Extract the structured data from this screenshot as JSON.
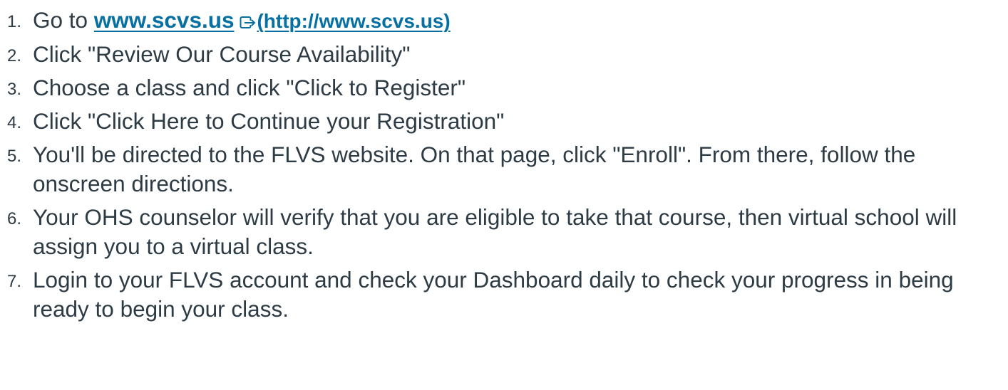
{
  "steps": [
    {
      "number": "1.",
      "prefix": "Go to ",
      "link_text": "www.scvs.us",
      "link_url_label": "(http://www.scvs.us)",
      "icon": "external-link-icon"
    },
    {
      "number": "2.",
      "text": "Click \"Review Our Course Availability\""
    },
    {
      "number": "3.",
      "text": "Choose a class and click \"Click to Register\""
    },
    {
      "number": "4.",
      "text": "Click \"Click Here to Continue your Registration\""
    },
    {
      "number": "5.",
      "text": "You'll be directed to the FLVS website. On that page, click \"Enroll\". From there, follow the onscreen directions."
    },
    {
      "number": "6.",
      "text": "Your OHS counselor will verify that you are eligible to take that course, then virtual school will assign you to a virtual class."
    },
    {
      "number": "7.",
      "text": "Login to your FLVS account and check your Dashboard daily to check your progress in being ready to begin your class."
    }
  ],
  "colors": {
    "text": "#2d3b45",
    "link": "#0770a3"
  }
}
